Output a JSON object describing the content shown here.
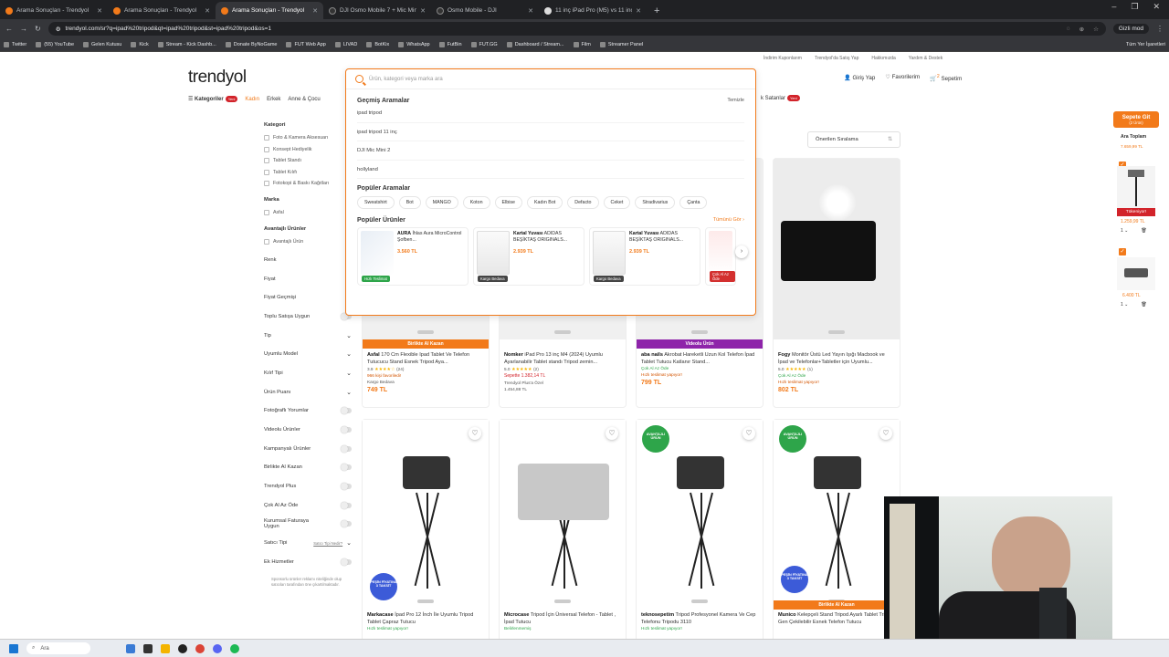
{
  "browser": {
    "tabs": [
      {
        "title": "Arama Sonuçları - Trendyol",
        "active": false
      },
      {
        "title": "Arama Sonuçları - Trendyol",
        "active": false
      },
      {
        "title": "Arama Sonuçları - Trendyol",
        "active": true
      },
      {
        "title": "DJI Osmo Mobile 7 + Mic Mini",
        "active": false
      },
      {
        "title": "Osmo Mobile - DJI",
        "active": false
      },
      {
        "title": "11 inç iPad Pro (M5) vs 11 inç i",
        "active": false
      }
    ],
    "url": "trendyol.com/sr?q=ipad%20tripod&qt=ipad%20tripod&st=ipad%20tripod&os=1",
    "incognito_label": "Gizli mod",
    "bookmarks": [
      "Twitter",
      "(55) YouTube",
      "Gelen Kutusu",
      "Kick",
      "Stream - Kick Dashb...",
      "Donate ByNoGame",
      "FUT Web App",
      "LIVAD",
      "BotKix",
      "WhatsApp",
      "FutBin",
      "FUT.GG",
      "Dashboard / Stream...",
      "Film",
      "Streamer Panel"
    ],
    "all_bookmarks": "Tüm Yer İşaretleri"
  },
  "header": {
    "top_links": [
      "İndirim Kuponlarım",
      "Trendyol'da Satış Yap",
      "Hakkımızda",
      "Yardım & Destek"
    ],
    "logo": "trendyol",
    "search_placeholder": "Ürün, kategori veya marka ara",
    "login": "Giriş Yap",
    "favorites": "Favorilerim",
    "cart": "Sepetim",
    "cart_count": "2"
  },
  "nav": {
    "categories": "Kategoriler",
    "new_badge": "Yeni",
    "items": [
      "Kadın",
      "Erkek",
      "Anne & Çocu"
    ],
    "right": "k Satanlar"
  },
  "search_dropdown": {
    "history_title": "Geçmiş Aramalar",
    "clear": "Temizle",
    "history": [
      "ipad tripod",
      "ipad tripod 11 inç",
      "DJI Mic Mini 2",
      "hollyland"
    ],
    "popular_title": "Popüler Aramalar",
    "popular": [
      "Sweatshirt",
      "Bot",
      "MANGO",
      "Koton",
      "Elbise",
      "Kadın Bot",
      "Defacto",
      "Ceket",
      "Stradivarius",
      "Çanta"
    ],
    "products_title": "Popüler Ürünler",
    "see_all": "Tümünü Gör",
    "products": [
      {
        "brand": "AURA",
        "name": "İhlas Aura MicroControl Şofben...",
        "price": "3.560 TL",
        "badge": "Hızlı Teslimat"
      },
      {
        "brand": "Kartal Yuvası",
        "name": "ADIDAS BEŞİKTAŞ ORIGINALS...",
        "price": "2.939 TL",
        "badge": "Kargo Bedava"
      },
      {
        "brand": "Kartal Yuvası",
        "name": "ADIDAS BEŞİKTAŞ ORIGINALS...",
        "price": "2.939 TL",
        "badge": "Kargo Bedava"
      },
      {
        "brand": "",
        "name": "",
        "price": "",
        "badge": "Çok Al Az Öde"
      }
    ]
  },
  "sidebar": {
    "category_title": "Kategori",
    "categories": [
      "Foto & Kamera Aksesuarı",
      "Konsept Hediyelik",
      "Tablet Standı",
      "Tablet Kılıfı",
      "Fotokopi & Baskı Kağıtları"
    ],
    "brand_title": "Marka",
    "brands": [
      "Asfal"
    ],
    "adv_title": "Avantajlı Ürünler",
    "adv": [
      "Avantajlı Ürün"
    ],
    "filters": [
      {
        "label": "Renk",
        "kind": "none"
      },
      {
        "label": "Fiyat",
        "kind": "none"
      },
      {
        "label": "Fiyat Geçmişi",
        "kind": "none"
      },
      {
        "label": "Toplu Satışa Uygun",
        "kind": "toggle"
      },
      {
        "label": "Tip",
        "kind": "chevron"
      },
      {
        "label": "Uyumlu Model",
        "kind": "chevron"
      },
      {
        "label": "Kılıf Tipi",
        "kind": "chevron"
      },
      {
        "label": "Ürün Puanı",
        "kind": "chevron"
      },
      {
        "label": "Fotoğraflı Yorumlar",
        "kind": "toggle"
      },
      {
        "label": "Videolu Ürünler",
        "kind": "toggle"
      },
      {
        "label": "Kampanyalı Ürünler",
        "kind": "toggle"
      },
      {
        "label": "Birlikte Al Kazan",
        "kind": "toggle"
      },
      {
        "label": "Trendyol Plus",
        "kind": "toggle"
      },
      {
        "label": "Çok Al Az Öde",
        "kind": "toggle"
      },
      {
        "label": "Kurumsal Faturaya Uygun",
        "kind": "toggle"
      },
      {
        "label": "Satıcı Tipi",
        "kind": "chevron",
        "extra": "Satıcı Tipi Nedir?"
      },
      {
        "label": "Ek Hizmetler",
        "kind": "toggle"
      }
    ],
    "info": "Sponsorlu ürünler reklamı niteliğinde olup satıcıları tarafından öne çıkartılmaktadır."
  },
  "sort": {
    "label": "Önerilen Sıralama"
  },
  "products_row1": [
    {
      "ribbon": "Birlikte Al Kazan",
      "ribbon_color": "#f27a1a",
      "brand": "Asfal",
      "name": "170 Cm Flexible Ipad Tablet Ve Telefon Tutucucu Stand Esnek Tripod Aya...",
      "rating": "3.9",
      "stars": "★★★★☆",
      "reviews": "(24)",
      "meta": "Kargo Bedava",
      "extra": "966 kişi favoriledi!",
      "price": "749 TL"
    },
    {
      "ribbon": "",
      "ribbon_color": "",
      "brand": "Nomker",
      "name": "iPad Pro 13 inç M4 (2024) Uyumlu Ayarlanabilir Tablet standı Tripod zemin...",
      "rating": "5.0",
      "stars": "★★★★★",
      "reviews": "(2)",
      "meta": "Trendyol Plus'a Özel",
      "extra": "Sepette 1.382,14 TL",
      "price": "1.454,88 TL"
    },
    {
      "ribbon": "Videolu Ürün",
      "ribbon_color": "#8e24aa",
      "brand": "aba nails",
      "name": "Akrobat Hareketli Uzun Kol Telefon İpad Tablet Tutucu Katlanır Stand...",
      "rating": "",
      "stars": "",
      "reviews": "",
      "meta": "Hızlı teslimat yapıyor!",
      "extra": "Çok Al Az Öde",
      "price": "799 TL"
    },
    {
      "ribbon": "",
      "ribbon_color": "",
      "brand": "Fogy",
      "name": "Monitör Üstü Led Yayın Işığı Macbook ve İpad ve Telefonlar+Tabletler için Uyumlu...",
      "rating": "5.0",
      "stars": "★★★★★",
      "reviews": "(1)",
      "meta": "Hızlı teslimat yapıyor!",
      "extra": "Çok Al Az Öde",
      "price": "802 TL"
    }
  ],
  "products_row2": [
    {
      "brand": "Markacase",
      "name": "İpad Pro 12 İnch İle Uyumlu Tripod Tablet Çapraz Tutucu",
      "meta": "Hızlı teslimat yapıyor!"
    },
    {
      "brand": "Microcase",
      "name": "Tripod İçin Üniversal Telefon - Tablet , İpad Tutucu",
      "meta": "Belirlenmemiş"
    },
    {
      "brand": "teknosepetim",
      "name": "Tripod Profesyonel Kamera Ve Cep Telefonu Tripodu 3110",
      "meta": "Hızlı teslimat yapıyor!"
    },
    {
      "brand": "Munico",
      "name": "Kelepçeli Stand Tripod Ayarlı Tablet Tripod Gen Çekilebilir Esnek Telefon Tutucu",
      "meta": "Birlikte Al Kazan"
    }
  ],
  "right_panel": {
    "cart_btn": "Sepete Git",
    "cart_sub": "(2 Ürün)",
    "subtotal_label": "Ara Toplam",
    "subtotal": "7.659,99 TL",
    "out_of_stock": "Tükeniyor!",
    "item1_price": "1.259,99 TL",
    "item1_qty": "1",
    "item2_price": "6.400 TL",
    "item2_qty": "1"
  },
  "badges": {
    "avantajli": "AVANTAJLI ÜRÜN",
    "pesin": "PEŞİN FİYATINA 3 TAKSİT"
  },
  "taskbar": {
    "search": "Ara"
  }
}
